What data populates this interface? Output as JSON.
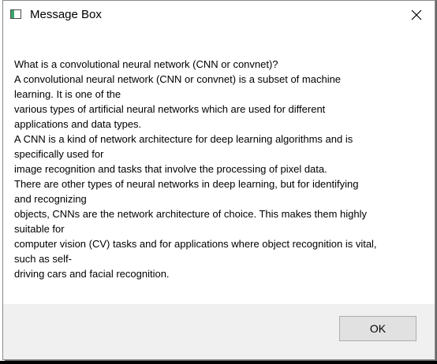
{
  "window": {
    "title": "Message Box",
    "close_icon": "close-icon",
    "app_icon": "window-icon"
  },
  "message": {
    "lines": [
      "What is a convolutional neural network (CNN or convnet)?",
      "A convolutional neural network (CNN or convnet) is a subset of machine",
      "learning. It is one of the",
      "various types of artificial neural networks which are used for different",
      "applications and data types.",
      "A CNN is a kind of network architecture for deep learning algorithms and is",
      "specifically used for",
      "image recognition and tasks that involve the processing of pixel data.",
      "There are other types of neural networks in deep learning, but for identifying",
      "and recognizing",
      "objects, CNNs are the network architecture of choice. This makes them highly",
      "suitable for",
      "computer vision (CV) tasks and for applications where object recognition is vital,",
      "such as self-",
      "driving cars and facial recognition."
    ]
  },
  "buttons": {
    "ok_label": "OK"
  },
  "colors": {
    "footer_bg": "#f0f0f0",
    "button_bg": "#e1e1e1",
    "button_border": "#adadad",
    "icon_accent": "#3aa870"
  }
}
